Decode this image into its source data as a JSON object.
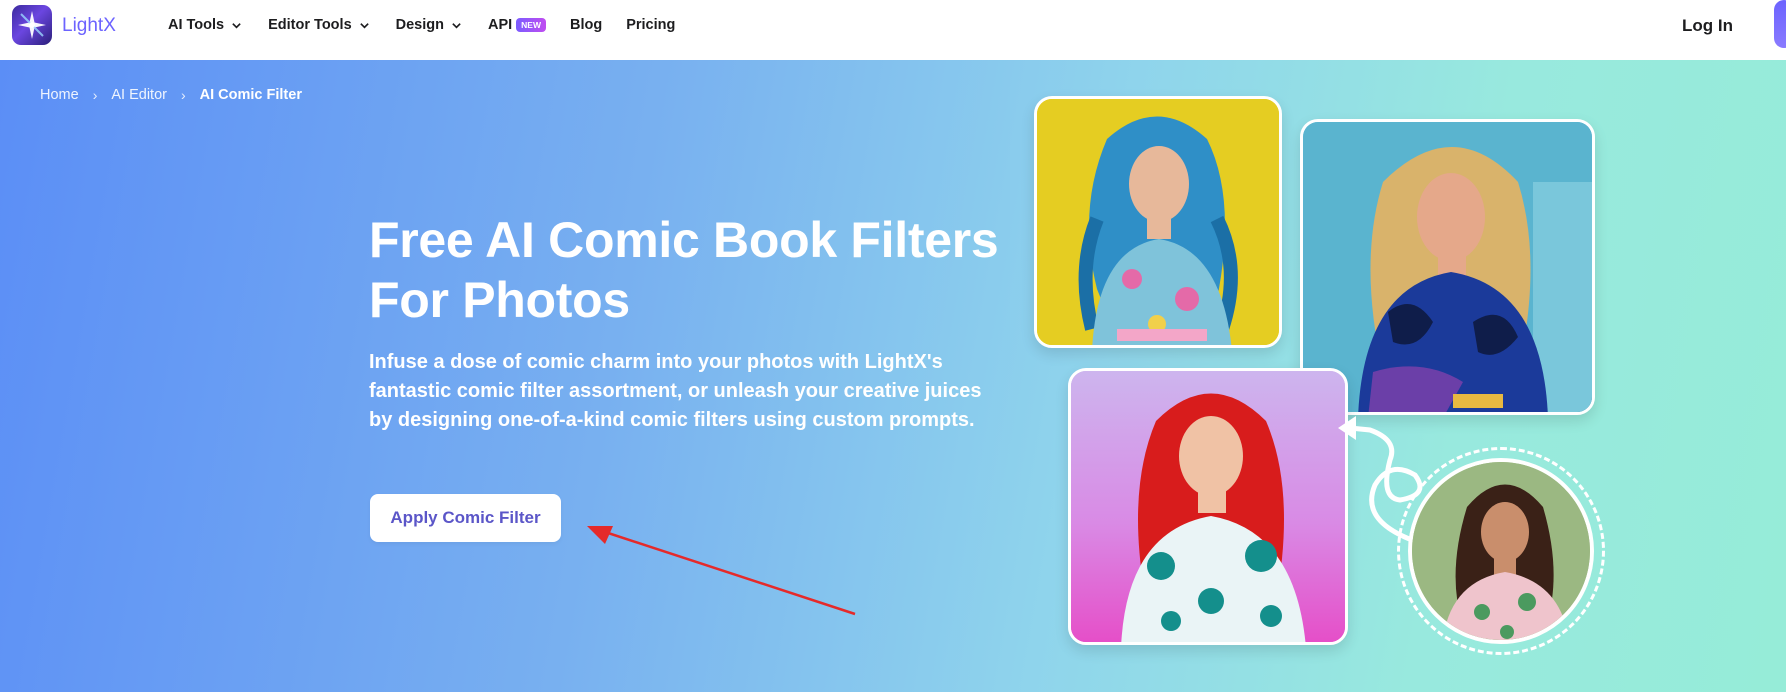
{
  "brand": {
    "name": "LightX",
    "logo_icon": "lightx-logo-icon"
  },
  "nav": {
    "items": [
      {
        "label": "AI Tools",
        "has_dropdown": true
      },
      {
        "label": "Editor Tools",
        "has_dropdown": true
      },
      {
        "label": "Design",
        "has_dropdown": true
      }
    ],
    "api_label": "API",
    "api_badge": "NEW",
    "blog_label": "Blog",
    "pricing_label": "Pricing",
    "login_label": "Log In"
  },
  "breadcrumb": {
    "home": "Home",
    "editor": "AI Editor",
    "current": "AI Comic Filter"
  },
  "hero": {
    "title_line1": "Free AI Comic Book Filters",
    "title_line2": "For Photos",
    "subtitle": "Infuse a dose of comic charm into your photos with LightX's fantastic comic filter assortment, or unleash your creative juices by designing one-of-a-kind comic filters using custom prompts.",
    "cta_label": "Apply Comic Filter"
  },
  "colors": {
    "accent": "#6c63ff",
    "cta_text": "#5b56c8",
    "arrow": "#e52a2a",
    "badge_start": "#7b5cff",
    "badge_end": "#c04cf0"
  }
}
